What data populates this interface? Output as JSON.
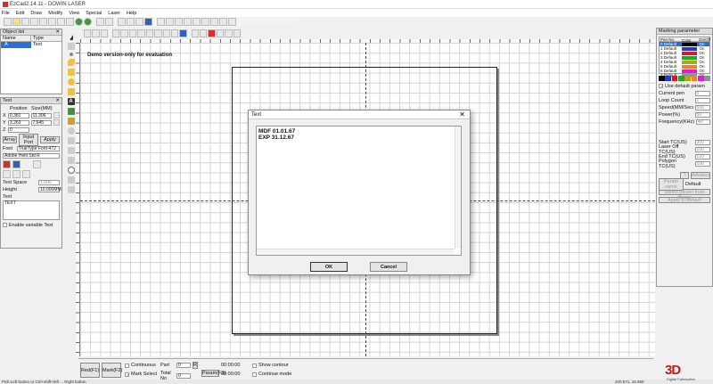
{
  "window": {
    "title": "EzCad2.14.11 - DOWIN LASER"
  },
  "menu": [
    "File",
    "Edit",
    "Draw",
    "Modify",
    "View",
    "Special",
    "Laser",
    "Help"
  ],
  "object_list": {
    "title": "Object list",
    "col_name": "Name",
    "col_type": "Type",
    "row_name": "A",
    "row_type": "Text"
  },
  "text_panel": {
    "title": "Text",
    "pos_header": "Position",
    "size_header": "Size(MM)",
    "x_label": "X",
    "x_value": "0.381",
    "x_size": "11.306",
    "y_label": "Y",
    "y_value": "3.263",
    "y_size": "7.645",
    "z_label": "Z",
    "z_value": "0",
    "tab_array": "Array",
    "tab_input": "Input Port",
    "apply": "Apply",
    "font_label": "Font",
    "font_type": "TrueType Font-472",
    "font_name": "Adobe Heiti Std R",
    "text_space_label": "Text Space",
    "text_space_value": "1.000",
    "height_label": "Height",
    "height_value": "10.000MM",
    "text_label": "Text",
    "text_value": "TEXT",
    "variable_text": "Enable variable Text"
  },
  "canvas": {
    "demo_notice": "Demo version-only for evaluation"
  },
  "dialog": {
    "title": "Text",
    "close": "✕",
    "content": "MDF 01.01.67\nEXP 31.12.67",
    "ok": "OK",
    "cancel": "Cancel"
  },
  "marking": {
    "title": "Marking parameter",
    "col_pen": "Pen No.",
    "col_color": "Color",
    "col_onoff": "On/Off",
    "pens": [
      {
        "name": "0 Default",
        "color": "#000000",
        "state": "On"
      },
      {
        "name": "1 Default",
        "color": "#1a3cd8",
        "state": "On"
      },
      {
        "name": "2 Default",
        "color": "#e01818",
        "state": "On"
      },
      {
        "name": "3 Default",
        "color": "#18b018",
        "state": "On"
      },
      {
        "name": "4 Default",
        "color": "#a8a818",
        "state": "On"
      },
      {
        "name": "5 Default",
        "color": "#f08418",
        "state": "On"
      },
      {
        "name": "6 Default",
        "color": "#e018e0",
        "state": "On"
      },
      {
        "name": "7 Default",
        "color": "#909090",
        "state": "On"
      }
    ],
    "use_default": "Use default param",
    "current_pen": "Current pen",
    "current_pen_val": "0",
    "loop_count": "Loop Count",
    "loop_count_val": "1",
    "speed": "Speed(MM/Second)",
    "speed_val": "500",
    "power": "Power(%)",
    "power_val": "50",
    "frequency": "Frequency(KHz)",
    "frequency_val": "40",
    "start_tc": "Start TC(US)",
    "start_tc_val": "300",
    "laser_off_tc": "Laser Off TC(US)",
    "laser_off_tc_val": "100",
    "end_tc": "End TC(US)",
    "end_tc_val": "120",
    "polygon_tc": "Polygon TC(US)",
    "polygon_tc_val": "100",
    "advance": "Advance",
    "param_name": "Param name",
    "param_default": "Default",
    "select_param": "Select param from library",
    "apply_default": "Apply to default"
  },
  "bottom": {
    "red": "Red(F1)",
    "mark": "Mark(F2)",
    "continuous": "Continuous",
    "mark_select": "Mark Select",
    "part": "Part",
    "part_val": "0",
    "total": "Total No",
    "total_val": "0",
    "time1": "00:00:00",
    "time2": "00:00:00",
    "param_btn": "Param(F3)",
    "show_contour": "Show contour",
    "continue_mode": "Continue mode"
  },
  "status": {
    "left": "Pick:Left button or Ctrl+shift+left ... Right button",
    "right": "200.571, 16.959"
  },
  "logo": {
    "big": "3D",
    "small": "Digital Fabrication"
  }
}
